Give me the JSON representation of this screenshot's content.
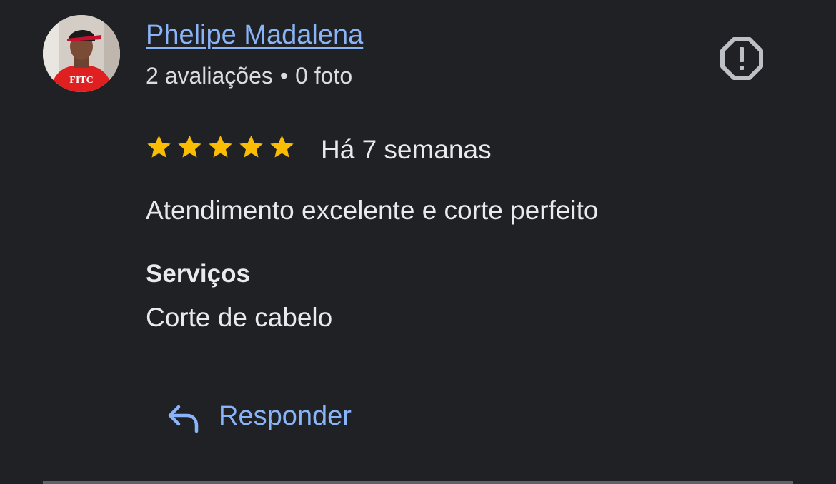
{
  "reviewer": {
    "name": "Phelipe Madalena",
    "reviews_count": "2 avaliações",
    "separator": "•",
    "photos_count": "0 foto",
    "avatar_shirt_text": "FITC"
  },
  "review": {
    "rating": 5,
    "rating_max": 5,
    "date": "Há 7 semanas",
    "text": "Atendimento excelente e corte perfeito",
    "services_heading": "Serviços",
    "services_value": "Corte de cabelo"
  },
  "actions": {
    "reply_label": "Responder",
    "report_icon": "report-flag-icon"
  },
  "colors": {
    "background": "#202124",
    "link": "#8ab4f8",
    "star": "#fbbc04",
    "text": "#e8eaed",
    "icon": "#bdc1c6"
  }
}
